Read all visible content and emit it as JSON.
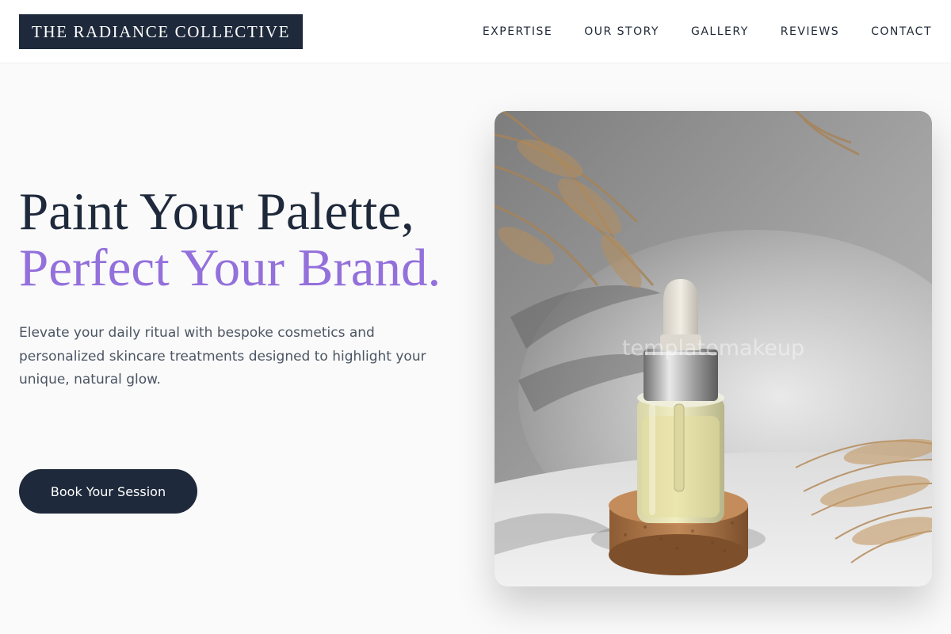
{
  "header": {
    "logo": "THE RADIANCE COLLECTIVE",
    "nav": [
      {
        "label": "EXPERTISE"
      },
      {
        "label": "OUR STORY"
      },
      {
        "label": "GALLERY"
      },
      {
        "label": "REVIEWS"
      },
      {
        "label": "CONTACT"
      }
    ]
  },
  "hero": {
    "headline_line1": "Paint Your Palette,",
    "headline_accent": "Perfect Your Brand.",
    "subtitle": "Elevate your daily ritual with bespoke cosmetics and personalized skincare treatments designed to highlight your unique, natural glow.",
    "cta_label": "Book Your Session",
    "image_watermark": "templatemakeup"
  },
  "colors": {
    "brand_dark": "#1e293b",
    "accent_lavender": "#9370db",
    "background": "#fafafa"
  }
}
